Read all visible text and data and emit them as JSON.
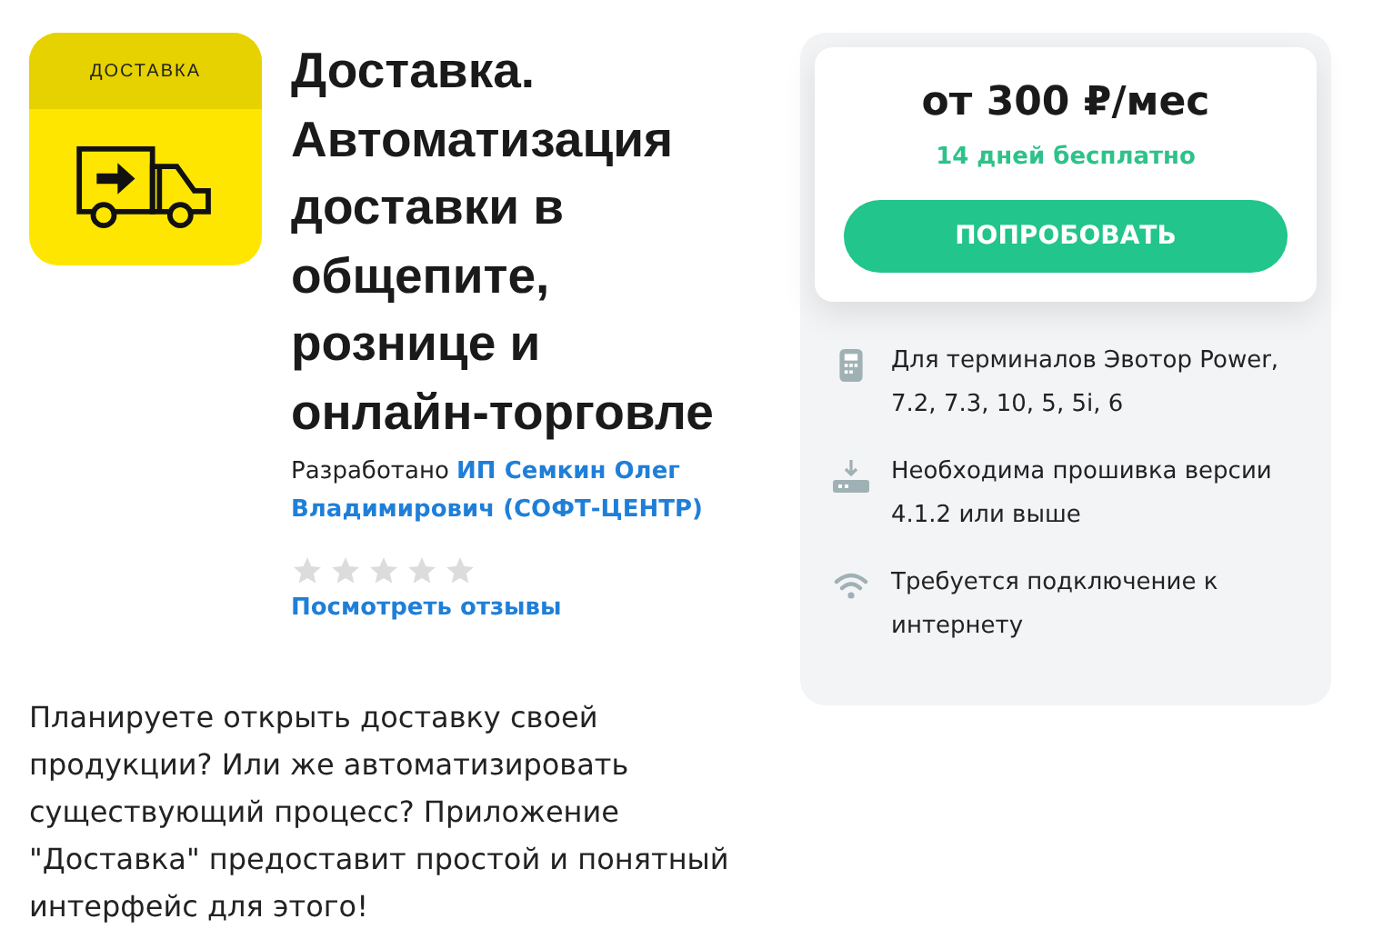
{
  "app": {
    "logo_label": "ДОСТАВКА",
    "title": "Доставка. Автоматизация доставки в общепите, рознице и онлайн-торговле",
    "developer": "Разработано **ИП Семкин Олег Владимирович (СОФТ-ЦЕНТР)**",
    "stars": 0,
    "reviews_link": "Посмотреть отзывы",
    "description": "Планируете открыть доставку своей продукции? Или же автоматизировать существующий процесс? Приложение \"Доставка\" предоставит простой и понятный интерфейс для этого!"
  },
  "pricing": {
    "price": "от 300 ₽/мес",
    "trial": "14 дней бесплатно",
    "button": "ПОПРОБОВАТЬ"
  },
  "requirements": [
    {
      "kind": "terminal",
      "text": "Для терминалов Эвотор Power, 7.2, 7.3, 10, 5, 5i, 6"
    },
    {
      "kind": "firmware",
      "text": "Необходима прошивка версии 4.1.2 или выше"
    },
    {
      "kind": "wifi",
      "text": "Требуется подключение к интернету"
    }
  ]
}
